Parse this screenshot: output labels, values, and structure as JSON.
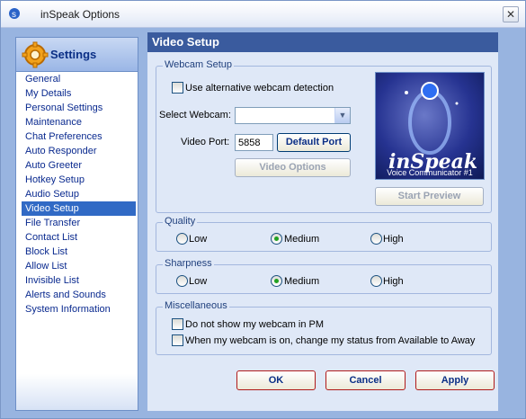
{
  "window": {
    "title": "inSpeak Options",
    "close_glyph": "✕"
  },
  "sidebar": {
    "title": "Settings",
    "items": [
      {
        "label": "General"
      },
      {
        "label": "My Details"
      },
      {
        "label": "Personal Settings"
      },
      {
        "label": "Maintenance"
      },
      {
        "label": "Chat Preferences"
      },
      {
        "label": "Auto Responder"
      },
      {
        "label": "Auto Greeter"
      },
      {
        "label": "Hotkey Setup"
      },
      {
        "label": "Audio Setup"
      },
      {
        "label": "Video Setup"
      },
      {
        "label": "File Transfer"
      },
      {
        "label": "Contact List"
      },
      {
        "label": "Block List"
      },
      {
        "label": "Allow List"
      },
      {
        "label": "Invisible List"
      },
      {
        "label": "Alerts and Sounds"
      },
      {
        "label": "System Information"
      }
    ],
    "selected": "Video Setup"
  },
  "main": {
    "title": "Video Setup",
    "webcam": {
      "group_label": "Webcam Setup",
      "alt_detection_label": "Use alternative webcam detection",
      "select_label": "Select Webcam:",
      "select_value": "",
      "port_label": "Video Port:",
      "port_value": "5858",
      "default_port_button": "Default Port",
      "video_options_button": "Video Options",
      "start_preview_button": "Start Preview",
      "brand_name": "inSpeak",
      "brand_tagline": "Voice Communicator #1"
    },
    "quality": {
      "group_label": "Quality",
      "options": [
        "Low",
        "Medium",
        "High"
      ],
      "selected": "Medium"
    },
    "sharpness": {
      "group_label": "Sharpness",
      "options": [
        "Low",
        "Medium",
        "High"
      ],
      "selected": "Medium"
    },
    "misc": {
      "group_label": "Miscellaneous",
      "option1": "Do not show my webcam in PM",
      "option2": "When my webcam is on, change my status from Available to Away"
    }
  },
  "buttons": {
    "ok": "OK",
    "cancel": "Cancel",
    "apply": "Apply"
  },
  "colors": {
    "accent": "#3a5b9e",
    "selection": "#316ac5",
    "link": "#0a2a8f"
  }
}
